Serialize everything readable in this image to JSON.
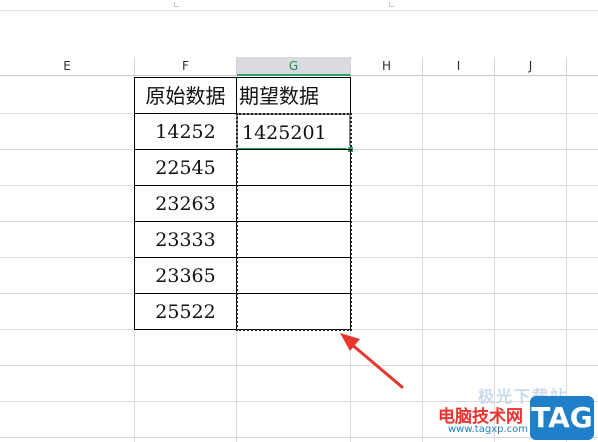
{
  "columns": [
    {
      "label": "E",
      "selected": false
    },
    {
      "label": "F",
      "selected": false
    },
    {
      "label": "G",
      "selected": true
    },
    {
      "label": "H",
      "selected": false
    },
    {
      "label": "I",
      "selected": false
    },
    {
      "label": "J",
      "selected": false
    }
  ],
  "table": {
    "header_f": "原始数据",
    "header_g": "期望数据",
    "rows": [
      {
        "f": "14252",
        "g": "1425201"
      },
      {
        "f": "22545",
        "g": ""
      },
      {
        "f": "23263",
        "g": ""
      },
      {
        "f": "23333",
        "g": ""
      },
      {
        "f": "23365",
        "g": ""
      },
      {
        "f": "25522",
        "g": ""
      }
    ]
  },
  "colors": {
    "accent_green": "#2ea567",
    "arrow_red": "#e8352f",
    "watermark_blue": "#1f7fc8",
    "watermark_red": "#e8352f"
  },
  "watermark": {
    "site_name": "电脑技术网",
    "site_url": "www.tagxp.com",
    "badge": "TAG",
    "faded_text": "极光下载站"
  }
}
